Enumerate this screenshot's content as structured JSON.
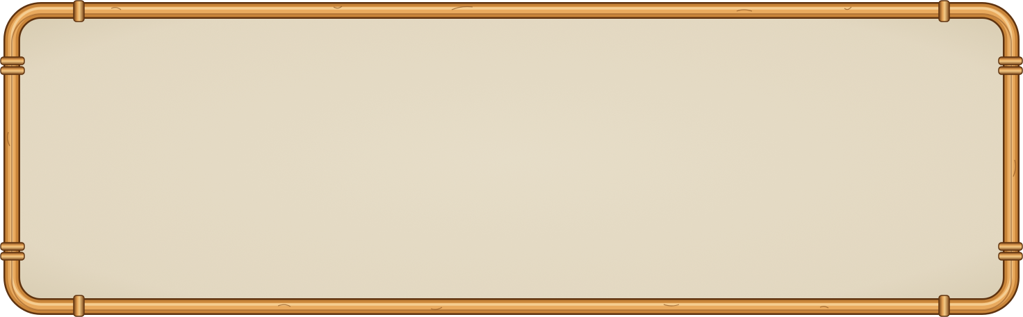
{
  "panel": {
    "style": "copper-pipe-frame",
    "colors": {
      "parchment": "#e6dcc6",
      "parchment_edge": "#d4c6a8",
      "copper_mid": "#c9853a",
      "copper_light": "#f0c27a",
      "copper_dark": "#7a4518",
      "copper_shadow": "#5e3310"
    },
    "joints": [
      "top-left",
      "top-right",
      "bottom-left",
      "bottom-right",
      "left-upper",
      "left-lower",
      "right-upper",
      "right-lower"
    ],
    "content": []
  }
}
